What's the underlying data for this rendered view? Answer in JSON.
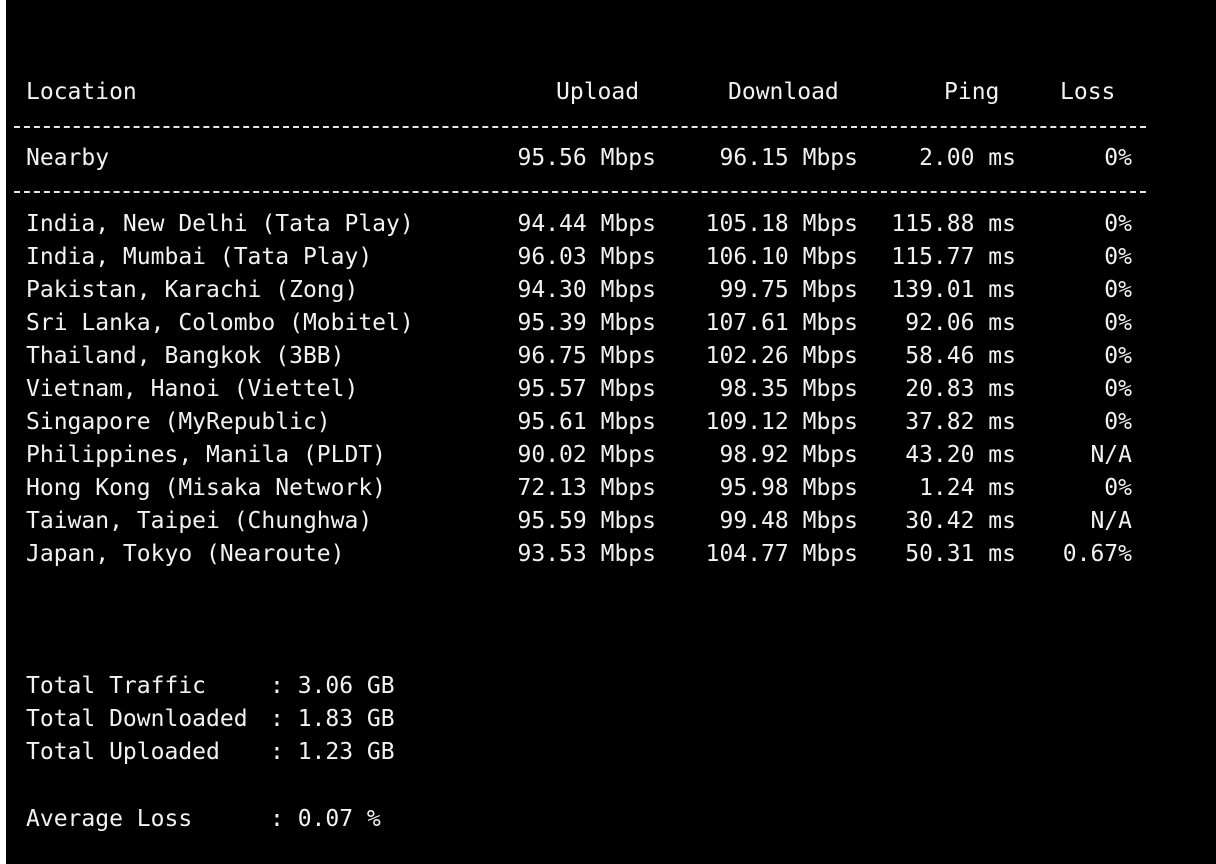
{
  "header": {
    "location": "Location",
    "upload": "Upload",
    "download": "Download",
    "ping": "Ping",
    "loss": "Loss"
  },
  "divider_char": "-",
  "nearby": {
    "location": "Nearby",
    "upload": "95.56 Mbps",
    "download": "96.15 Mbps",
    "ping": "2.00 ms",
    "loss": "0%"
  },
  "rows": [
    {
      "location": "India, New Delhi (Tata Play)",
      "upload": "94.44 Mbps",
      "download": "105.18 Mbps",
      "ping": "115.88 ms",
      "loss": "0%"
    },
    {
      "location": "India, Mumbai (Tata Play)",
      "upload": "96.03 Mbps",
      "download": "106.10 Mbps",
      "ping": "115.77 ms",
      "loss": "0%"
    },
    {
      "location": "Pakistan, Karachi (Zong)",
      "upload": "94.30 Mbps",
      "download": "99.75 Mbps",
      "ping": "139.01 ms",
      "loss": "0%"
    },
    {
      "location": "Sri Lanka, Colombo (Mobitel)",
      "upload": "95.39 Mbps",
      "download": "107.61 Mbps",
      "ping": "92.06 ms",
      "loss": "0%"
    },
    {
      "location": "Thailand, Bangkok (3BB)",
      "upload": "96.75 Mbps",
      "download": "102.26 Mbps",
      "ping": "58.46 ms",
      "loss": "0%"
    },
    {
      "location": "Vietnam, Hanoi (Viettel)",
      "upload": "95.57 Mbps",
      "download": "98.35 Mbps",
      "ping": "20.83 ms",
      "loss": "0%"
    },
    {
      "location": "Singapore (MyRepublic)",
      "upload": "95.61 Mbps",
      "download": "109.12 Mbps",
      "ping": "37.82 ms",
      "loss": "0%"
    },
    {
      "location": "Philippines, Manila (PLDT)",
      "upload": "90.02 Mbps",
      "download": "98.92 Mbps",
      "ping": "43.20 ms",
      "loss": "N/A"
    },
    {
      "location": "Hong Kong (Misaka Network)",
      "upload": "72.13 Mbps",
      "download": "95.98 Mbps",
      "ping": "1.24 ms",
      "loss": "0%"
    },
    {
      "location": "Taiwan, Taipei (Chunghwa)",
      "upload": "95.59 Mbps",
      "download": "99.48 Mbps",
      "ping": "30.42 ms",
      "loss": "N/A"
    },
    {
      "location": "Japan, Tokyo (Nearoute)",
      "upload": "93.53 Mbps",
      "download": "104.77 Mbps",
      "ping": "50.31 ms",
      "loss": "0.67%"
    }
  ],
  "summary": {
    "total_traffic": {
      "label": "Total Traffic",
      "value": ": 3.06 GB"
    },
    "total_downloaded": {
      "label": "Total Downloaded",
      "value": ": 1.83 GB"
    },
    "total_uploaded": {
      "label": "Total Uploaded",
      "value": ": 1.23 GB"
    },
    "average_loss": {
      "label": "Average Loss",
      "value": ": 0.07 %"
    }
  },
  "colors": {
    "background": "#000000",
    "foreground": "#f2f2f2"
  }
}
